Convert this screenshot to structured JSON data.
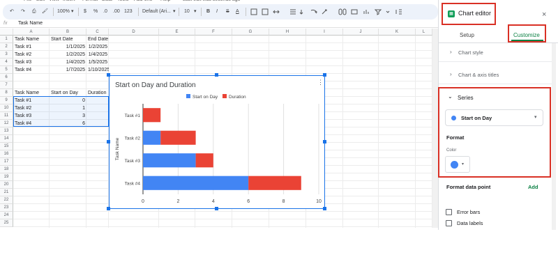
{
  "menu": [
    "File",
    "Edit",
    "View",
    "Insert",
    "Format",
    "Data",
    "Tools",
    "Add-ons",
    "Help",
    "Last edit was seconds ago"
  ],
  "toolbar": {
    "undo": "↶",
    "redo": "↷",
    "print": "⎙",
    "paint_format": "🖌",
    "zoom": "100%",
    "currency": "$",
    "percent": "%",
    "decimal_less": ".0",
    "decimal_more": ".00",
    "number_format": "123",
    "font": "Default (Ari...",
    "font_size": "10",
    "bold": "B",
    "italic": "I",
    "strike": "S",
    "text_color": "A"
  },
  "formula_bar": {
    "fx": "fx",
    "value": "Task Name"
  },
  "columns": [
    "A",
    "B",
    "C",
    "D",
    "E",
    "F",
    "G",
    "H",
    "I",
    "J",
    "K",
    "L"
  ],
  "rows": [
    "1",
    "2",
    "3",
    "4",
    "5",
    "6",
    "7",
    "8",
    "9",
    "10",
    "11",
    "12",
    "13",
    "14",
    "15",
    "16",
    "17",
    "18",
    "19",
    "20",
    "21",
    "22",
    "23",
    "24",
    "25"
  ],
  "table1": {
    "headers": [
      "Task Name",
      "Start Date",
      "End Date"
    ],
    "rows": [
      [
        "Task #1",
        "1/1/2025",
        "1/2/2025"
      ],
      [
        "Task #2",
        "1/2/2025",
        "1/4/2025"
      ],
      [
        "Task #3",
        "1/4/2025",
        "1/5/2025"
      ],
      [
        "Task #4",
        "1/7/2025",
        "1/10/2025"
      ]
    ]
  },
  "table2": {
    "headers": [
      "Task Name",
      "Start on Day",
      "Duration"
    ],
    "rows": [
      [
        "Task #1",
        "0"
      ],
      [
        "Task #2",
        "1"
      ],
      [
        "Task #3",
        "3"
      ],
      [
        "Task #4",
        "6"
      ]
    ]
  },
  "chart_data": {
    "type": "bar",
    "orientation": "horizontal",
    "stacked": true,
    "title": "Start on Day and Duration",
    "ylabel": "Task Name",
    "xlabel": "",
    "categories": [
      "Task #1",
      "Task #2",
      "Task #3",
      "Task #4"
    ],
    "series": [
      {
        "name": "Start on Day",
        "values": [
          0,
          1,
          3,
          6
        ],
        "color": "#4285f4"
      },
      {
        "name": "Duration",
        "values": [
          1,
          2,
          1,
          3
        ],
        "color": "#ea4335"
      }
    ],
    "xlim": [
      0,
      10
    ],
    "xticks": [
      "0",
      "2",
      "4",
      "6",
      "8",
      "10"
    ],
    "grid": true,
    "legend": "top"
  },
  "chart_menu": "⋮",
  "editor": {
    "icon": "▦",
    "title": "Chart editor",
    "close": "×",
    "tab_setup": "Setup",
    "tab_customize": "Customize",
    "sections": [
      "Chart style",
      "Chart & axis titles"
    ],
    "series_header": "Series",
    "series_selected": "Start on Day",
    "format_label": "Format",
    "color_label": "Color",
    "format_data_point": "Format data point",
    "add_label": "Add",
    "checkboxes": [
      "Error bars",
      "Data labels"
    ],
    "chevron_right": "›",
    "chevron_down": "⌄",
    "caret": "▾",
    "accent_color": "#0b8043",
    "highlight_color": "#d93025"
  }
}
